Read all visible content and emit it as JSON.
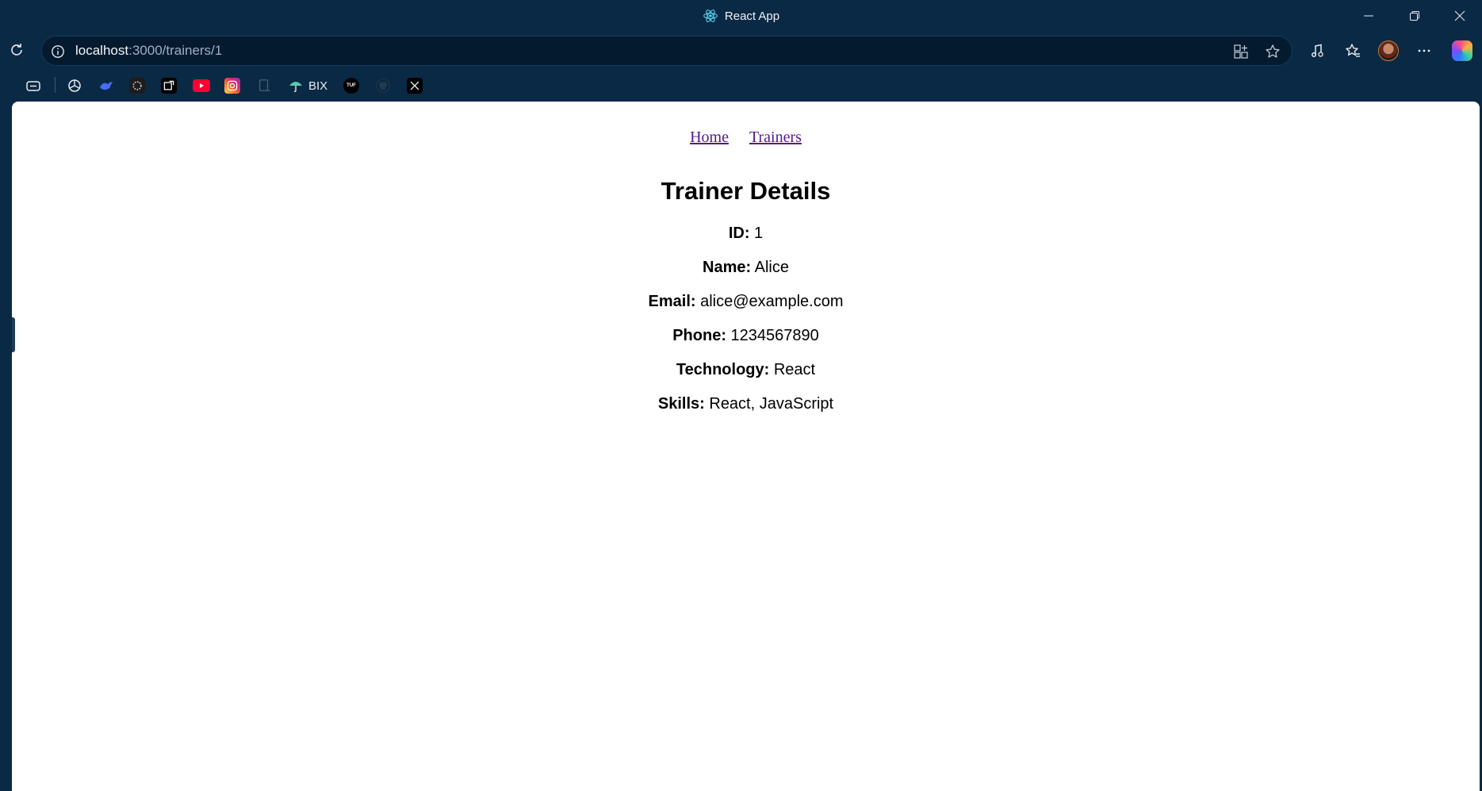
{
  "window": {
    "title": "React App"
  },
  "browser": {
    "url_host": "localhost",
    "url_rest": ":3000/trainers/1"
  },
  "bookmarks": [
    {
      "name": "tab-bookmark",
      "label": ""
    },
    {
      "name": "chatgpt",
      "label": ""
    },
    {
      "name": "bookmark-2",
      "label": ""
    },
    {
      "name": "bookmark-3",
      "label": ""
    },
    {
      "name": "bookmark-4",
      "label": ""
    },
    {
      "name": "youtube",
      "label": ""
    },
    {
      "name": "instagram",
      "label": ""
    },
    {
      "name": "bookmark-7",
      "label": ""
    },
    {
      "name": "bix",
      "label": "BIX"
    },
    {
      "name": "tuf",
      "label": ""
    },
    {
      "name": "github",
      "label": ""
    },
    {
      "name": "x",
      "label": ""
    }
  ],
  "nav": {
    "home": "Home",
    "trainers": "Trainers"
  },
  "page": {
    "title": "Trainer Details",
    "details": [
      {
        "label": "ID:",
        "value": " 1"
      },
      {
        "label": "Name:",
        "value": " Alice"
      },
      {
        "label": "Email:",
        "value": " alice@example.com"
      },
      {
        "label": "Phone:",
        "value": " 1234567890"
      },
      {
        "label": "Technology:",
        "value": " React"
      },
      {
        "label": "Skills:",
        "value": " React, JavaScript"
      }
    ]
  },
  "colors": {
    "chrome_bg": "#0a2944",
    "address_bg": "#041a2f",
    "visited_link": "#551a8b"
  }
}
